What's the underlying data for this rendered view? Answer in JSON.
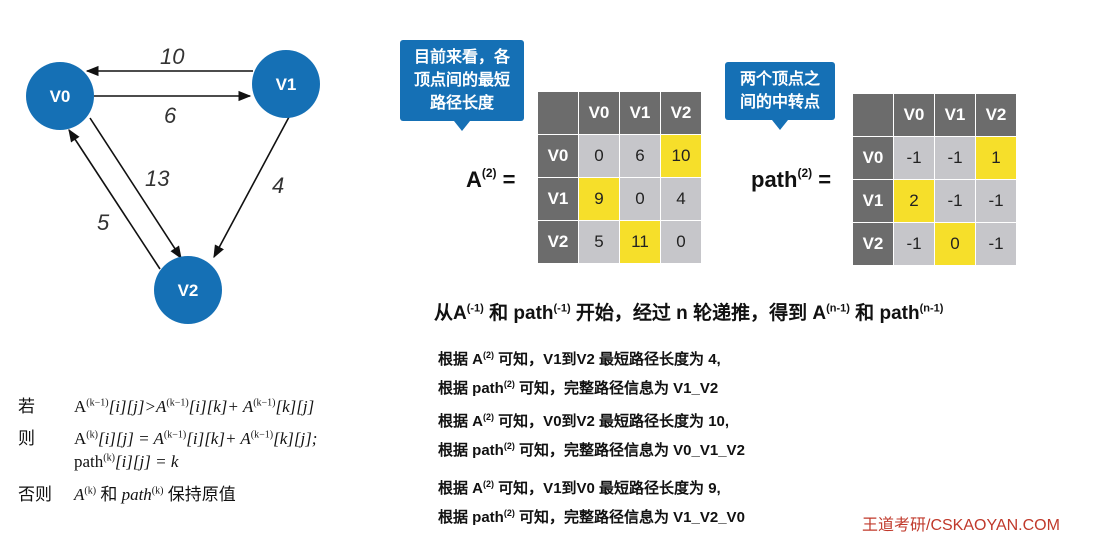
{
  "graph": {
    "vertices": [
      "V0",
      "V1",
      "V2"
    ],
    "edges": [
      {
        "from": "V1",
        "to": "V0",
        "weight": "10"
      },
      {
        "from": "V0",
        "to": "V1",
        "weight": "6"
      },
      {
        "from": "V0",
        "to": "V2",
        "weight": "13"
      },
      {
        "from": "V1",
        "to": "V2",
        "weight": "4"
      },
      {
        "from": "V2",
        "to": "V0",
        "weight": "5"
      }
    ]
  },
  "callouts": {
    "distance": "目前来看，各\n顶点间的最短\n路径长度",
    "path": "两个顶点之\n间的中转点"
  },
  "matrixA": {
    "label": "A",
    "label_sup": "(2)",
    "label_eq": " =",
    "headers": [
      "V0",
      "V1",
      "V2"
    ],
    "rows": [
      {
        "header": "V0",
        "cells": [
          "0",
          "6",
          "10"
        ]
      },
      {
        "header": "V1",
        "cells": [
          "9",
          "0",
          "4"
        ]
      },
      {
        "header": "V2",
        "cells": [
          "5",
          "11",
          "0"
        ]
      }
    ],
    "highlighted": [
      [
        0,
        2
      ],
      [
        1,
        0
      ],
      [
        2,
        1
      ]
    ],
    "highlight_color": "#f6df2a"
  },
  "matrixPath": {
    "label": "path",
    "label_sup": "(2)",
    "label_eq": " =",
    "headers": [
      "V0",
      "V1",
      "V2"
    ],
    "rows": [
      {
        "header": "V0",
        "cells": [
          "-1",
          "-1",
          "1"
        ]
      },
      {
        "header": "V1",
        "cells": [
          "2",
          "-1",
          "-1"
        ]
      },
      {
        "header": "V2",
        "cells": [
          "-1",
          "0",
          "-1"
        ]
      }
    ],
    "highlighted": [
      [
        0,
        2
      ],
      [
        1,
        0
      ],
      [
        2,
        1
      ]
    ],
    "highlight_color": "#f6df2a"
  },
  "headline": {
    "p1": "从A",
    "s1": "(-1)",
    "p2": " 和 path",
    "s2": "(-1)",
    "p3": " 开始，经过 n 轮递推，得到 A",
    "s3": "(n-1)",
    "p4": " 和 path",
    "s4": "(n-1)"
  },
  "notes": [
    {
      "a_pre": "根据 A",
      "a_sup": "(2)",
      "a_post": " 可知，V1到V2 最短路径长度为 4,",
      "p_pre": "根据 path",
      "p_sup": "(2)",
      "p_post": "  可知，完整路径信息为 V1_V2"
    },
    {
      "a_pre": "根据 A",
      "a_sup": "(2)",
      "a_post": " 可知，V0到V2 最短路径长度为 10,",
      "p_pre": "根据 path",
      "p_sup": "(2)",
      "p_post": "  可知，完整路径信息为 V0_V1_V2"
    },
    {
      "a_pre": "根据 A",
      "a_sup": "(2)",
      "a_post": " 可知，V1到V0 最短路径长度为 9,",
      "p_pre": "根据 path",
      "p_sup": "(2)",
      "p_post": "  可知，完整路径信息为 V1_V2_V0"
    }
  ],
  "formula": {
    "line1": {
      "kw": "若",
      "t1": "A",
      "s1": "(k−1)",
      "t2": "[i][j]>A",
      "s2": "(k−1)",
      "t3": "[i][k]+ A",
      "s3": "(k−1)",
      "t4": "[k][j]"
    },
    "line2": {
      "kw": "则",
      "t1": "A",
      "s1": "(k)",
      "t2": "[i][j] = A",
      "s2": "(k−1)",
      "t3": "[i][k]+ A",
      "s3": "(k−1)",
      "t4": "[k][j];"
    },
    "line3": {
      "t1": "path",
      "s1": "(k)",
      "t2": "[i][j] = k"
    },
    "line4": {
      "kw": "否则",
      "t1": "A",
      "s1": "(k)",
      "t2": " 和 ",
      "t3": "path",
      "s3": "(k)",
      "t4": " 保持原值"
    }
  },
  "brand": "王道考研/CSKAOYAN.COM",
  "colors": {
    "node": "#1570b5",
    "callout": "#1570b5",
    "header": "#6c6c6c",
    "cell": "#c6c6ca",
    "brand": "#c0392b"
  }
}
